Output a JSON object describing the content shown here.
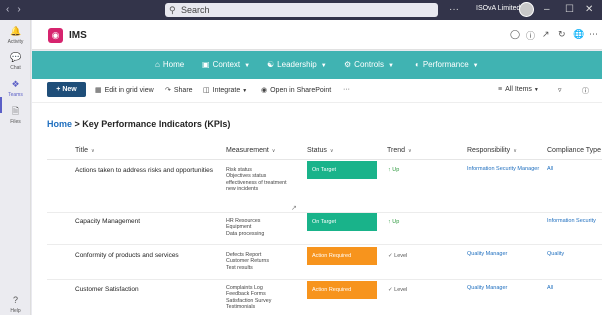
{
  "topbar": {
    "search_placeholder": "Search",
    "org_name": "ISOvA Limited",
    "more": "···",
    "win_min": "–",
    "win_max": "☐",
    "win_close": "✕"
  },
  "rail": {
    "items": [
      {
        "label": "Activity",
        "icon": "bell-icon"
      },
      {
        "label": "Chat",
        "icon": "chat-icon"
      },
      {
        "label": "Teams",
        "icon": "teams-icon"
      },
      {
        "label": "Files",
        "icon": "file-icon"
      },
      {
        "label": "Help",
        "icon": "help-icon"
      }
    ]
  },
  "app": {
    "title": "IMS"
  },
  "site_nav": {
    "items": [
      {
        "label": "Home",
        "icon": "home-icon"
      },
      {
        "label": "Context",
        "icon": "book-icon"
      },
      {
        "label": "Leadership",
        "icon": "handshake-icon"
      },
      {
        "label": "Controls",
        "icon": "cogs-icon"
      },
      {
        "label": "Performance",
        "icon": "chart-icon"
      }
    ]
  },
  "commands": {
    "new": "New",
    "grid": "Edit in grid view",
    "share": "Share",
    "integrate": "Integrate",
    "sharepoint": "Open in SharePoint",
    "more": "···",
    "view": "All Items"
  },
  "breadcrumb": {
    "home": "Home",
    "separator": " > ",
    "current": "Key Performance Indicators (KPIs)"
  },
  "table": {
    "columns": [
      "Title",
      "Measurement",
      "Status",
      "Trend",
      "Responsibility",
      "Compliance Type"
    ],
    "rows": [
      {
        "title": "Actions taken to address risks and opportunities",
        "measurement": [
          "Risk status",
          "Objectives status",
          "effectiveness of treatment",
          "new incidents"
        ],
        "status": "On Target",
        "status_color": "#19b38a",
        "trend": "Up",
        "trend_icon": "↑",
        "responsibility": "Information Security Manager",
        "compliance": "All"
      },
      {
        "title": "Capacity Management",
        "measurement": [
          "HR Resources",
          "Equipment",
          "Data processing"
        ],
        "status": "On Target",
        "status_color": "#19b38a",
        "trend": "Up",
        "trend_icon": "↑",
        "responsibility": "",
        "compliance": "Information Security"
      },
      {
        "title": "Conformity of products and services",
        "measurement": [
          "Defects Report",
          "Customer Returns",
          "Test results"
        ],
        "status": "Action Required",
        "status_color": "#f7941d",
        "trend": "Level",
        "trend_icon": "✓",
        "responsibility": "Quality Manager",
        "compliance": "Quality"
      },
      {
        "title": "Customer Satisfaction",
        "measurement": [
          "Complaints Log",
          "Feedback Forms",
          "Satisfaction Survey",
          "Testimonials"
        ],
        "status": "Action Required",
        "status_color": "#f7941d",
        "trend": "Level",
        "trend_icon": "✓",
        "responsibility": "Quality Manager",
        "compliance": "All"
      }
    ]
  }
}
